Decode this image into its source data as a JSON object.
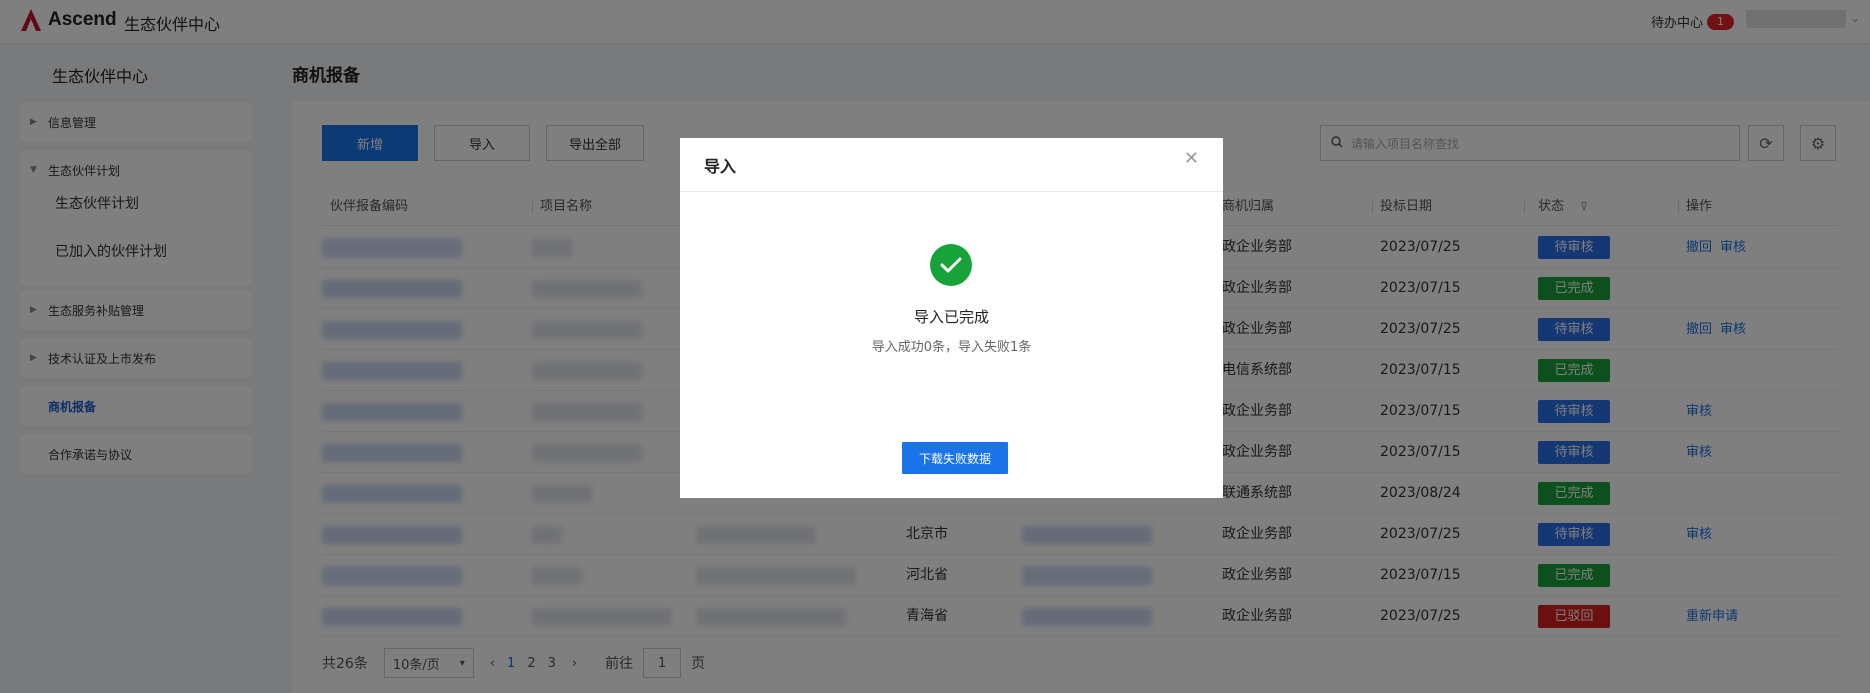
{
  "topbar": {
    "logo_text": "Ascend",
    "app_title": "生态伙伴中心",
    "todo_label": "待办中心",
    "todo_count": "1"
  },
  "sidebar": {
    "title": "生态伙伴中心",
    "items": [
      {
        "label": "信息管理"
      },
      {
        "label": "生态伙伴计划",
        "children": [
          "生态伙伴计划",
          "已加入的伙伴计划"
        ]
      },
      {
        "label": "生态服务补贴管理"
      },
      {
        "label": "技术认证及上市发布"
      },
      {
        "label": "商机报备"
      },
      {
        "label": "合作承诺与协议"
      }
    ]
  },
  "main": {
    "title": "商机报备",
    "buttons": {
      "add": "新增",
      "import": "导入",
      "export_all": "导出全部"
    },
    "search_placeholder": "请输入项目名称查找"
  },
  "table": {
    "columns": [
      "伙伴报备编码",
      "项目名称",
      "商机归属",
      "投标日期",
      "状态",
      "操作"
    ],
    "rows": [
      {
        "region": "",
        "owner": "政企业务部",
        "date": "2023/07/25",
        "status": "待审核",
        "ops": [
          "撤回",
          "审核"
        ]
      },
      {
        "region": "",
        "owner": "政企业务部",
        "date": "2023/07/15",
        "status": "已完成",
        "ops": []
      },
      {
        "region": "",
        "owner": "政企业务部",
        "date": "2023/07/25",
        "status": "待审核",
        "ops": [
          "撤回",
          "审核"
        ]
      },
      {
        "region": "",
        "owner": "电信系统部",
        "date": "2023/07/15",
        "status": "已完成",
        "ops": []
      },
      {
        "region": "",
        "owner": "政企业务部",
        "date": "2023/07/15",
        "status": "待审核",
        "ops": [
          "审核"
        ]
      },
      {
        "region": "",
        "owner": "政企业务部",
        "date": "2023/07/15",
        "status": "待审核",
        "ops": [
          "审核"
        ]
      },
      {
        "region": "",
        "owner": "联通系统部",
        "date": "2023/08/24",
        "status": "已完成",
        "ops": []
      },
      {
        "region": "北京市",
        "owner": "政企业务部",
        "date": "2023/07/25",
        "status": "待审核",
        "ops": [
          "审核"
        ]
      },
      {
        "region": "河北省",
        "owner": "政企业务部",
        "date": "2023/07/15",
        "status": "已完成",
        "ops": []
      },
      {
        "region": "青海省",
        "owner": "政企业务部",
        "date": "2023/07/25",
        "status": "已驳回",
        "ops": [
          "重新申请"
        ]
      }
    ]
  },
  "pager": {
    "total": "共26条",
    "page_size": "10条/页",
    "pages": [
      "1",
      "2",
      "3"
    ],
    "goto_label": "前往",
    "goto_value": "1",
    "page_suffix": "页"
  },
  "modal": {
    "title": "导入",
    "result_title": "导入已完成",
    "result_detail": "导入成功0条，导入失败1条",
    "download_button": "下载失败数据"
  },
  "colors": {
    "primary": "#1a73e8",
    "pending": "#2a6ee8",
    "done": "#18a33a",
    "rejected": "#d81f1f",
    "logo_red": "#c8102e"
  }
}
